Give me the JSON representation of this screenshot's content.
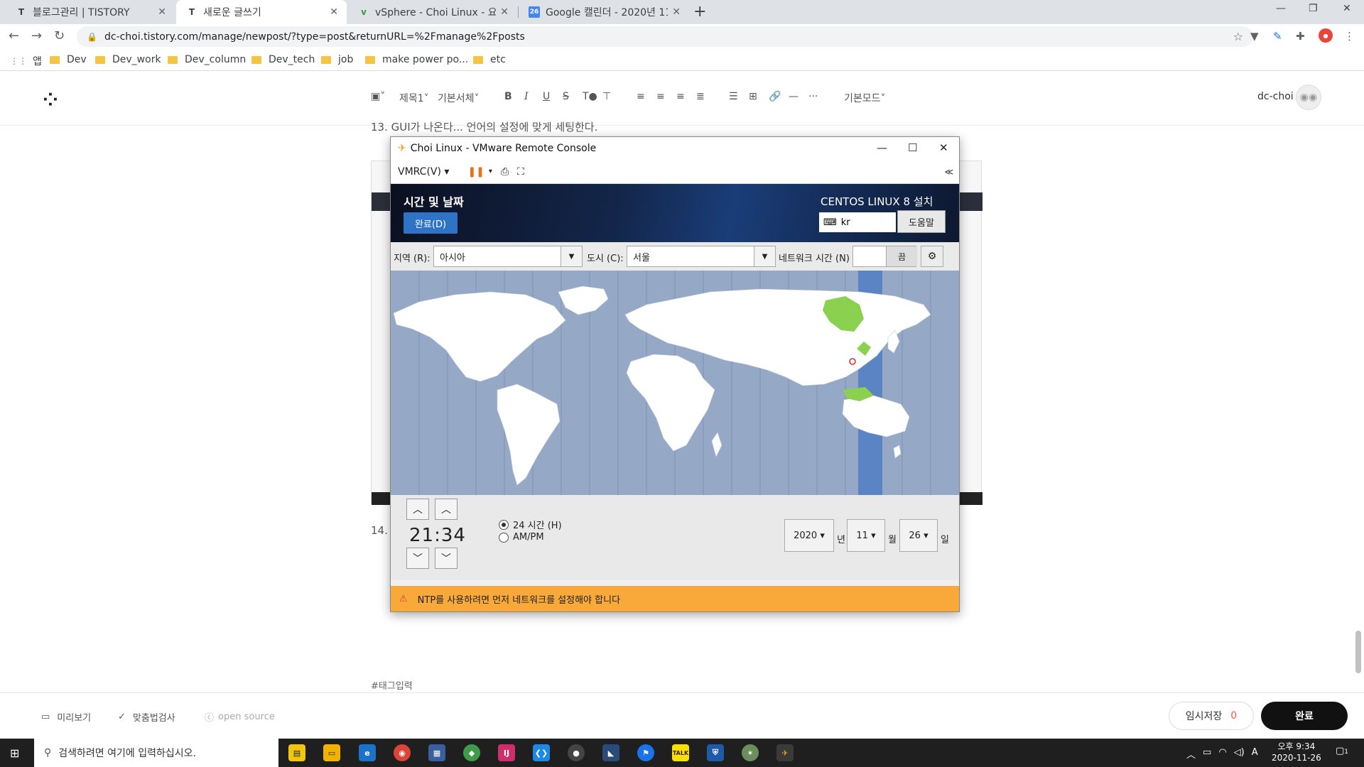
{
  "browser": {
    "tabs": [
      {
        "label": "블로그관리 | TISTORY",
        "favicon": "T"
      },
      {
        "label": "새로운 글쓰기",
        "favicon": "T"
      },
      {
        "label": "vSphere - Choi Linux - 요약",
        "favicon": "v"
      },
      {
        "label": "Google 캘린더 - 2020년 11월",
        "favicon": "26"
      }
    ],
    "url": "dc-choi.tistory.com/manage/newpost/?type=post&returnURL=%2Fmanage%2Fposts",
    "bookmarks": [
      "앱",
      "Dev",
      "Dev_work",
      "Dev_column",
      "Dev_tech",
      "job",
      "make power po...",
      "etc"
    ]
  },
  "editor": {
    "toolbar": {
      "heading": "제목1",
      "font": "기본서체",
      "mode": "기본모드"
    },
    "user": "dc-choi",
    "step13": "13. GUI가 나온다... 언어의 설정에 맞게 세팅한다.",
    "step14": "14.",
    "tag_placeholder": "#태그입력",
    "bottom": {
      "preview": "미리보기",
      "spellcheck": "맞춤법검사",
      "opensource": "open source",
      "save_draft": "임시저장",
      "draft_count": "0",
      "publish": "완료"
    }
  },
  "vmrc": {
    "title": "Choi Linux - VMware Remote Console",
    "menu": "VMRC(V)",
    "screen_title": "시간 및 날짜",
    "done": "완료(D)",
    "product": "CENTOS LINUX 8 설치",
    "keyboard": "kr",
    "help": "도움말",
    "region_label": "지역 (R):",
    "region": "아시아",
    "city_label": "도시 (C):",
    "city": "서울",
    "ntp_label": "네트워크 시간 (N)",
    "ntp_state": "끔",
    "time": "21:34",
    "fmt24": "24 시간 (H)",
    "fmtampm": "AM/PM",
    "year": "2020",
    "year_unit": "년",
    "month": "11",
    "month_unit": "월",
    "day": "26",
    "day_unit": "일",
    "warning": "NTP를 사용하려면 먼저 네트워크를 설정해야 합니다",
    "colors": {
      "map_sea": "#95a9c6",
      "tz_highlight": "#5b84c4",
      "land": "#ffffff",
      "selected_zone": "#8bd150",
      "warning": "#f8a93a"
    }
  },
  "taskbar": {
    "search": "검색하려면 여기에 입력하십시오.",
    "time": "오후 9:34",
    "date": "2020-11-26",
    "notifications": "1"
  }
}
